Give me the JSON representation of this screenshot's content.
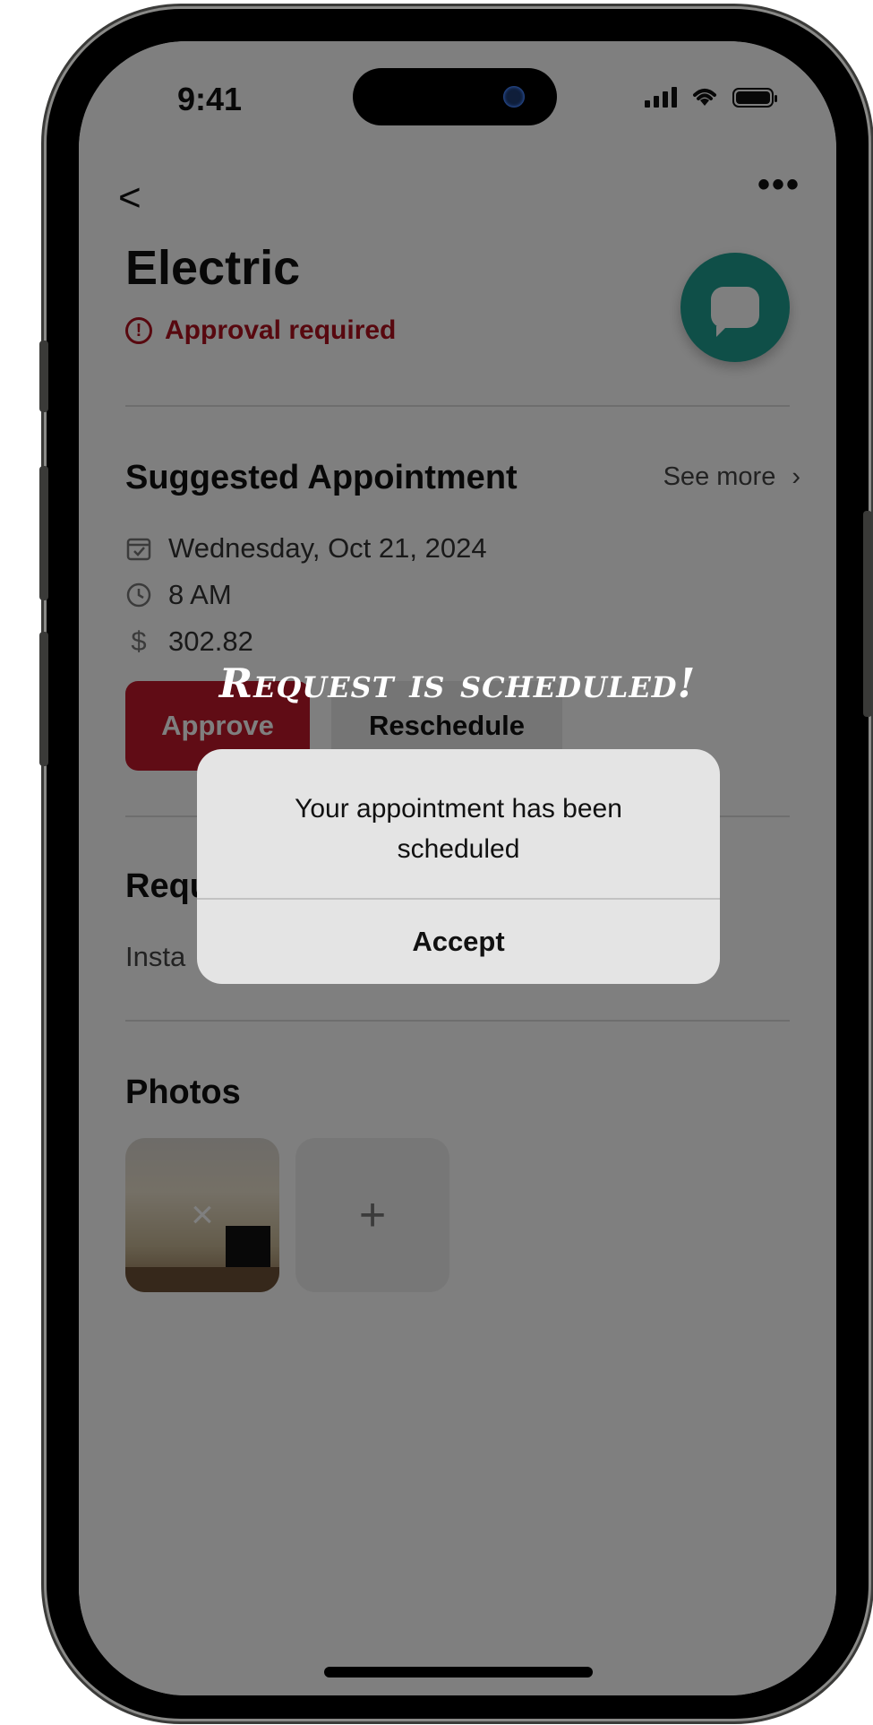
{
  "status": {
    "time": "9:41"
  },
  "header": {
    "back": "<",
    "more": "•••"
  },
  "job": {
    "title": "Electric",
    "approval": "Approval required"
  },
  "appointment": {
    "heading": "Suggested Appointment",
    "see_more": "See more",
    "date": "Wednesday, Oct 21, 2024",
    "time": "8 AM",
    "price": "302.82",
    "approve_label": "Approve",
    "reschedule_label": "Reschedule"
  },
  "request": {
    "heading_partial": "Requ",
    "text_partial": "Insta"
  },
  "photos": {
    "heading": "Photos",
    "add": "+",
    "remove": "×"
  },
  "overlay": {
    "banner": "Request is scheduled!",
    "dialog_message": "Your appointment has been scheduled",
    "dialog_button": "Accept"
  },
  "colors": {
    "accent_red": "#c0192a",
    "fab_teal": "#1f9e90"
  },
  "icons": [
    "back-chevron-icon",
    "more-icon",
    "alert-circle-icon",
    "chat-bubble-icon",
    "calendar-check-icon",
    "clock-icon",
    "dollar-icon",
    "chevron-right-icon",
    "close-icon",
    "plus-icon"
  ]
}
